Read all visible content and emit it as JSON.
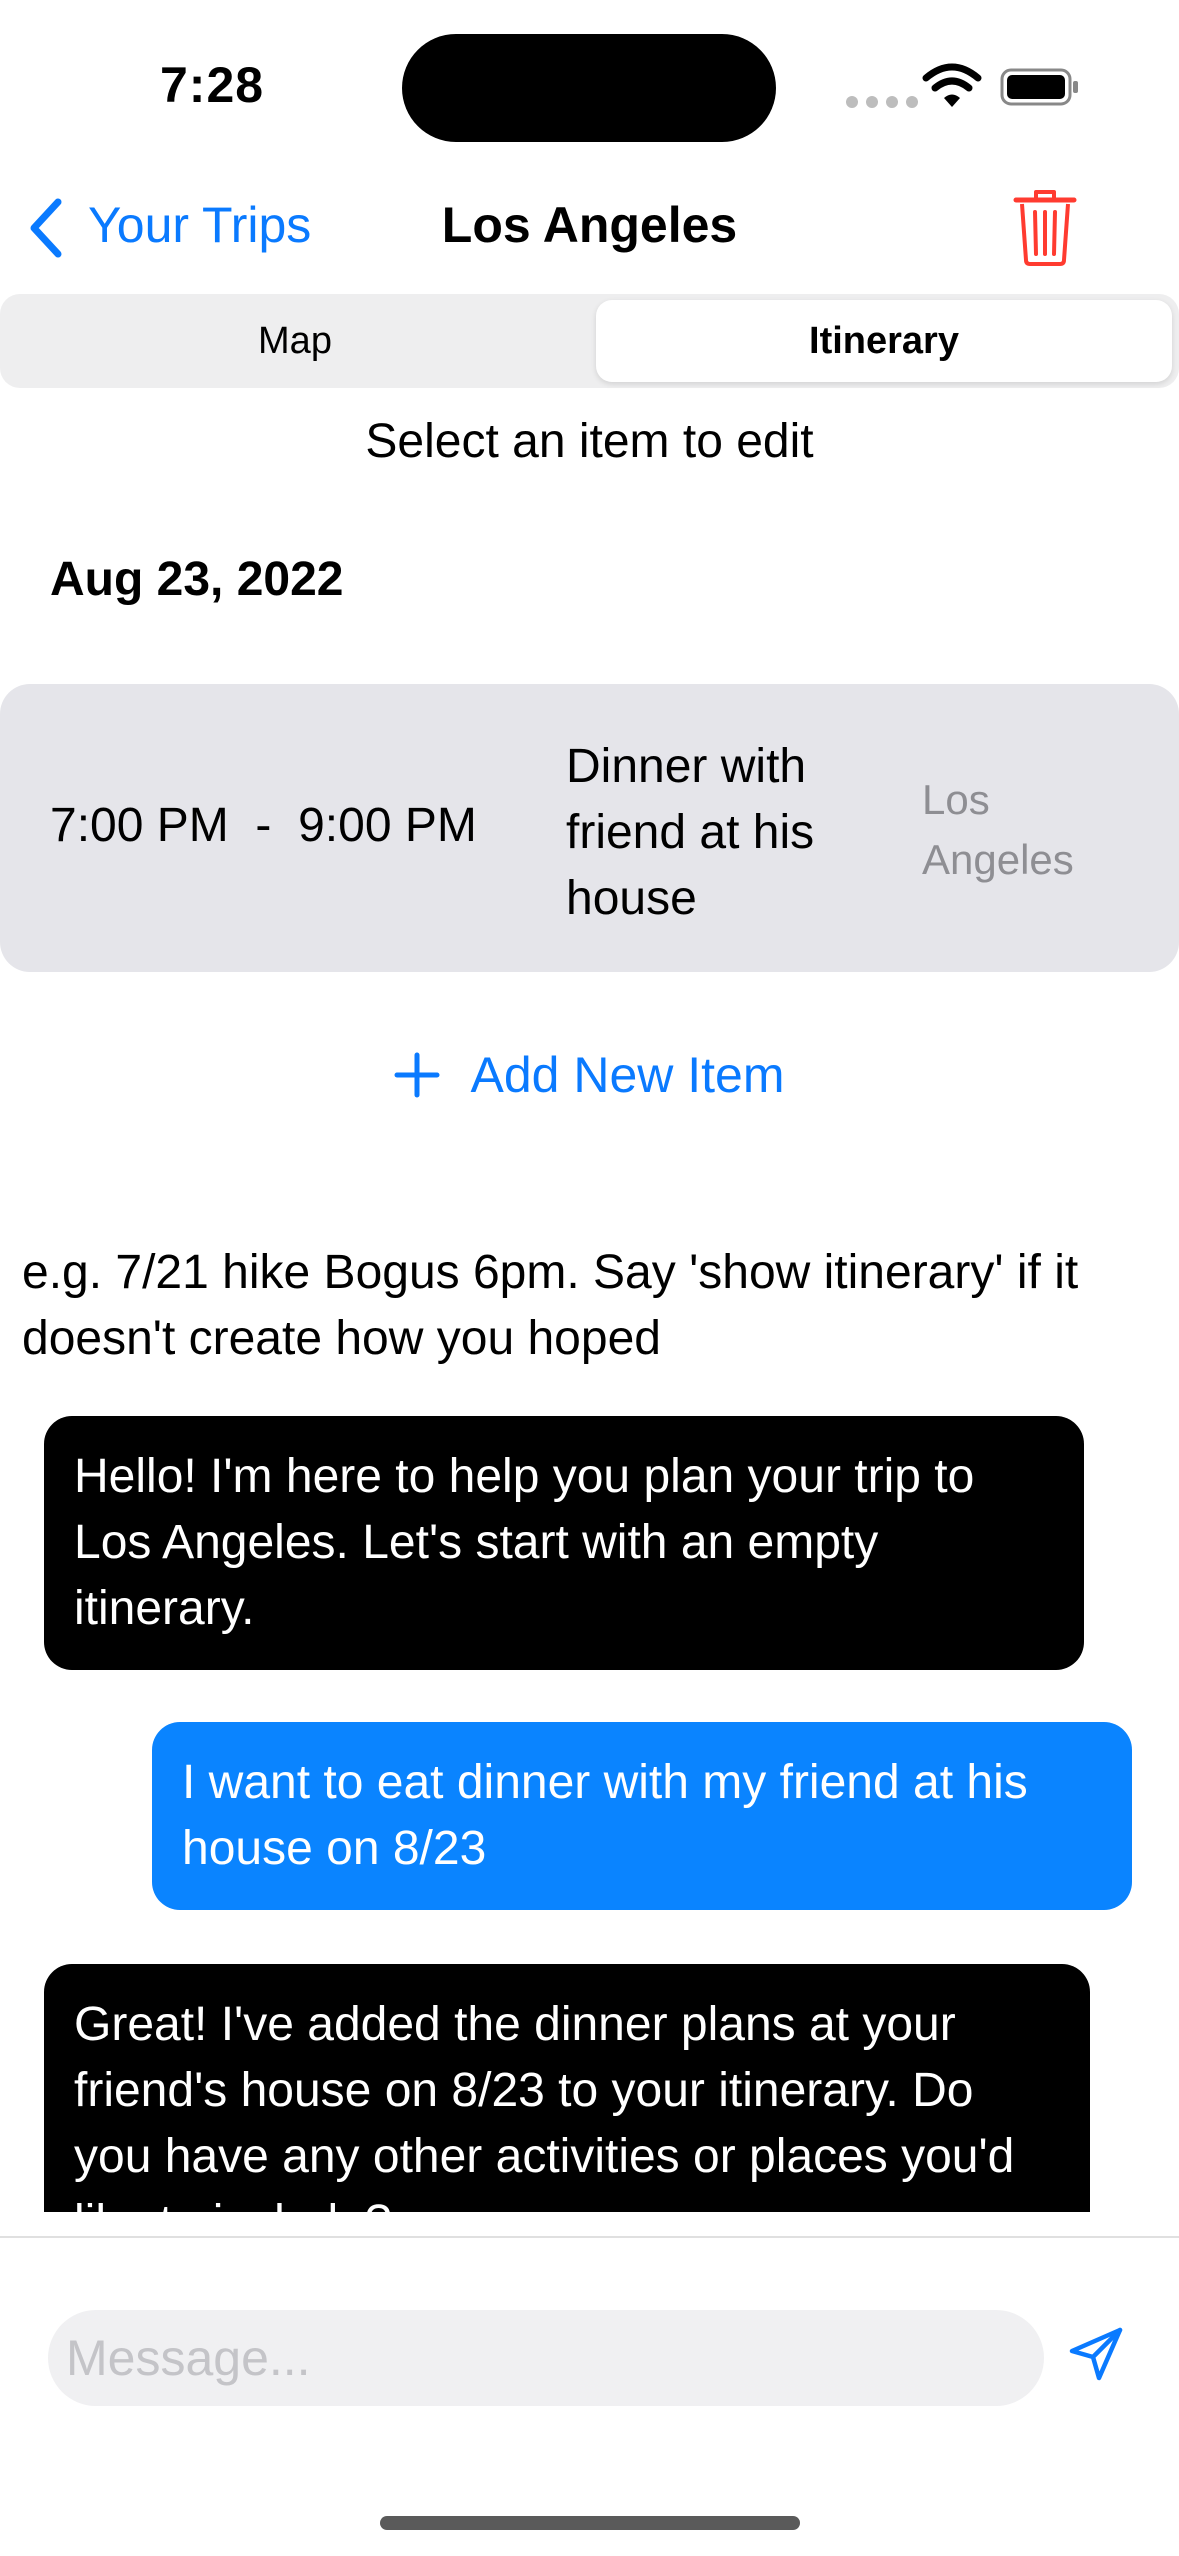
{
  "status_bar": {
    "time": "7:28"
  },
  "nav": {
    "back_label": "Your Trips",
    "title": "Los Angeles"
  },
  "segments": {
    "map": "Map",
    "itinerary": "Itinerary",
    "selected": "Itinerary"
  },
  "itinerary": {
    "hint": "Select an item to edit",
    "date": "Aug 23, 2022",
    "items": [
      {
        "time": "7:00 PM  -  9:00 PM",
        "description": "Dinner with friend at his house",
        "location": "Los Angeles"
      }
    ],
    "add_label": "Add New Item"
  },
  "chat": {
    "hint": "e.g. 7/21 hike Bogus 6pm. Say 'show itinerary' if it doesn't create how you hoped",
    "messages": [
      {
        "sender": "assistant",
        "text": "Hello! I'm here to help you plan your trip to Los Angeles. Let's start with an empty itinerary."
      },
      {
        "sender": "user",
        "text": "I want to eat dinner with my friend at his house on 8/23"
      },
      {
        "sender": "assistant",
        "text": "Great! I've added the dinner plans at your friend's house on 8/23 to your itinerary. Do you have any other activities or places you'd like to include?"
      }
    ],
    "input_placeholder": "Message..."
  },
  "colors": {
    "accent": "#0a7aff",
    "user_bubble": "#0a84ff",
    "assistant_bubble": "#000000",
    "delete": "#ff3b30"
  },
  "icons": [
    "chevron-left-icon",
    "trash-icon",
    "plus-icon",
    "send-icon",
    "wifi-icon",
    "battery-icon"
  ]
}
